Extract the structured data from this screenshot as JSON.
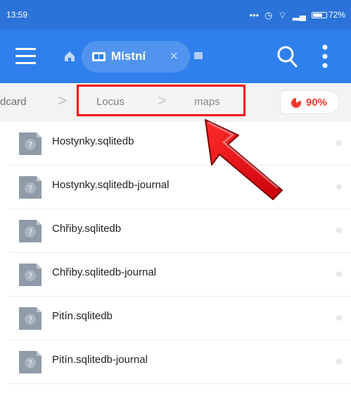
{
  "status_bar": {
    "time": "13:59",
    "battery": "72%"
  },
  "app_bar": {
    "tab_label": "Místní"
  },
  "breadcrumb": {
    "items": [
      "dcard",
      "Locus",
      "maps"
    ],
    "separator": ">",
    "storage_percent": "90%"
  },
  "files": [
    {
      "name": "Hostynky.sqlitedb",
      "icon": "unknown-file-icon"
    },
    {
      "name": "Hostynky.sqlitedb-journal",
      "icon": "unknown-file-icon"
    },
    {
      "name": "Chřiby.sqlitedb",
      "icon": "unknown-file-icon"
    },
    {
      "name": "Chřiby.sqlitedb-journal",
      "icon": "unknown-file-icon"
    },
    {
      "name": "Pitín.sqlitedb",
      "icon": "unknown-file-icon"
    },
    {
      "name": "Pitín.sqlitedb-journal",
      "icon": "unknown-file-icon"
    }
  ],
  "annotation": {
    "highlight": "path",
    "arrow": "red"
  },
  "colors": {
    "status_bar": "#2b73d9",
    "app_bar": "#2f80ec",
    "accent_red": "#f10f12",
    "storage_red": "#ee3c2c",
    "file_icon": "#8f9ba8"
  }
}
